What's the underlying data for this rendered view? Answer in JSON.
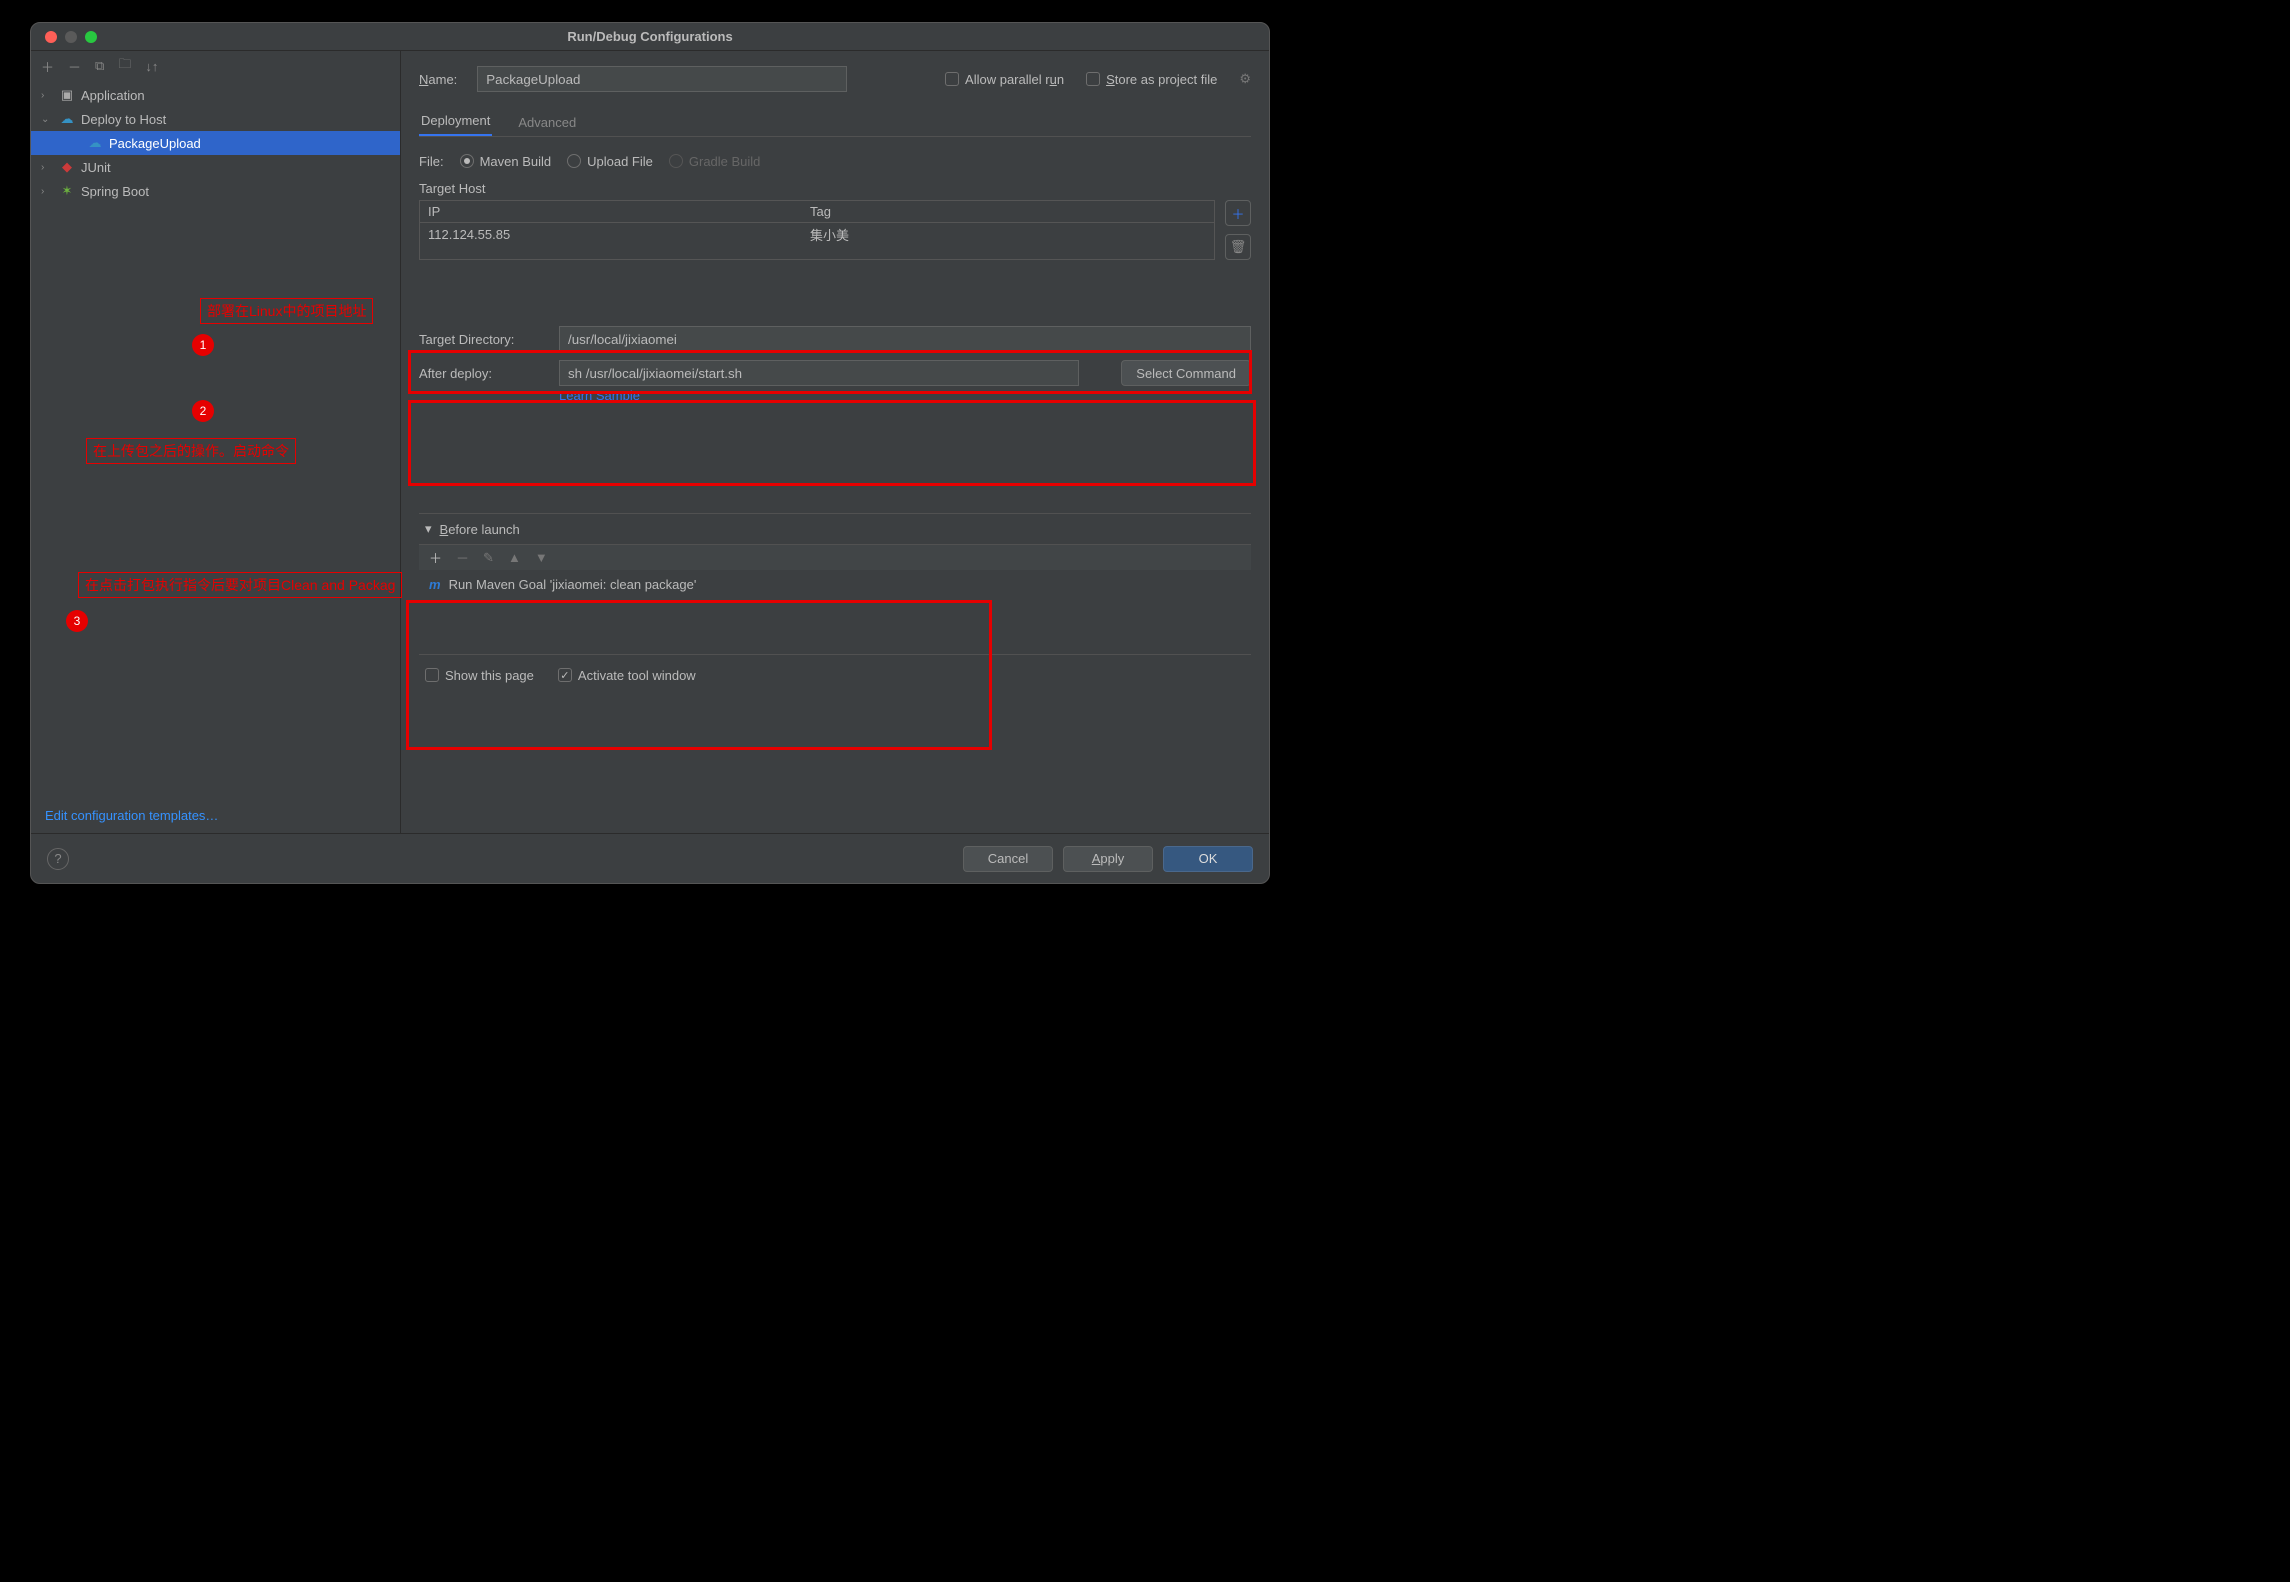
{
  "title": "Run/Debug Configurations",
  "sidebar": {
    "toolbar_icons": [
      "plus",
      "minus",
      "copy",
      "folder",
      "sort"
    ],
    "items": [
      {
        "label": "Application",
        "icon": "folder",
        "expand": ">"
      },
      {
        "label": "Deploy to Host",
        "icon": "cloud",
        "expand": "v"
      },
      {
        "label": "PackageUpload",
        "icon": "cloud",
        "selected": true
      },
      {
        "label": "JUnit",
        "icon": "junit",
        "expand": ">"
      },
      {
        "label": "Spring Boot",
        "icon": "spring",
        "expand": ">"
      }
    ],
    "edit_templates": "Edit configuration templates…"
  },
  "main": {
    "name_label": "Name:",
    "name_value": "PackageUpload",
    "allow_parallel": "Allow parallel run",
    "store_as_project": "Store as project file",
    "tabs": [
      "Deployment",
      "Advanced"
    ],
    "active_tab": 0,
    "file_label": "File:",
    "file_radios": [
      "Maven Build",
      "Upload File",
      "Gradle Build"
    ],
    "file_radio_selected": 0,
    "file_radio_disabled": 2,
    "target_host_label": "Target Host",
    "host_header": {
      "ip": "IP",
      "tag": "Tag"
    },
    "host_row": {
      "ip": "112.124.55.85",
      "tag": "集小美"
    },
    "target_dir_label": "Target Directory:",
    "target_dir_value": "/usr/local/jixiaomei",
    "after_deploy_label": "After deploy:",
    "after_deploy_value": "sh /usr/local/jixiaomei/start.sh",
    "select_command": "Select Command",
    "learn_sample": "Learn Sample",
    "before_launch_label": "Before launch",
    "before_launch_task": "Run Maven Goal 'jixiaomei: clean package'",
    "show_this_page": "Show this page",
    "activate_tool_window": "Activate tool window"
  },
  "annotations": {
    "a1": "部署在Linux中的项目地址",
    "a2": "在上传包之后的操作。启动命令",
    "a3": "在点击打包执行指令后要对项目Clean and Packag",
    "b1": "1",
    "b2": "2",
    "b3": "3"
  },
  "footer": {
    "cancel": "Cancel",
    "apply": "Apply",
    "ok": "OK"
  }
}
